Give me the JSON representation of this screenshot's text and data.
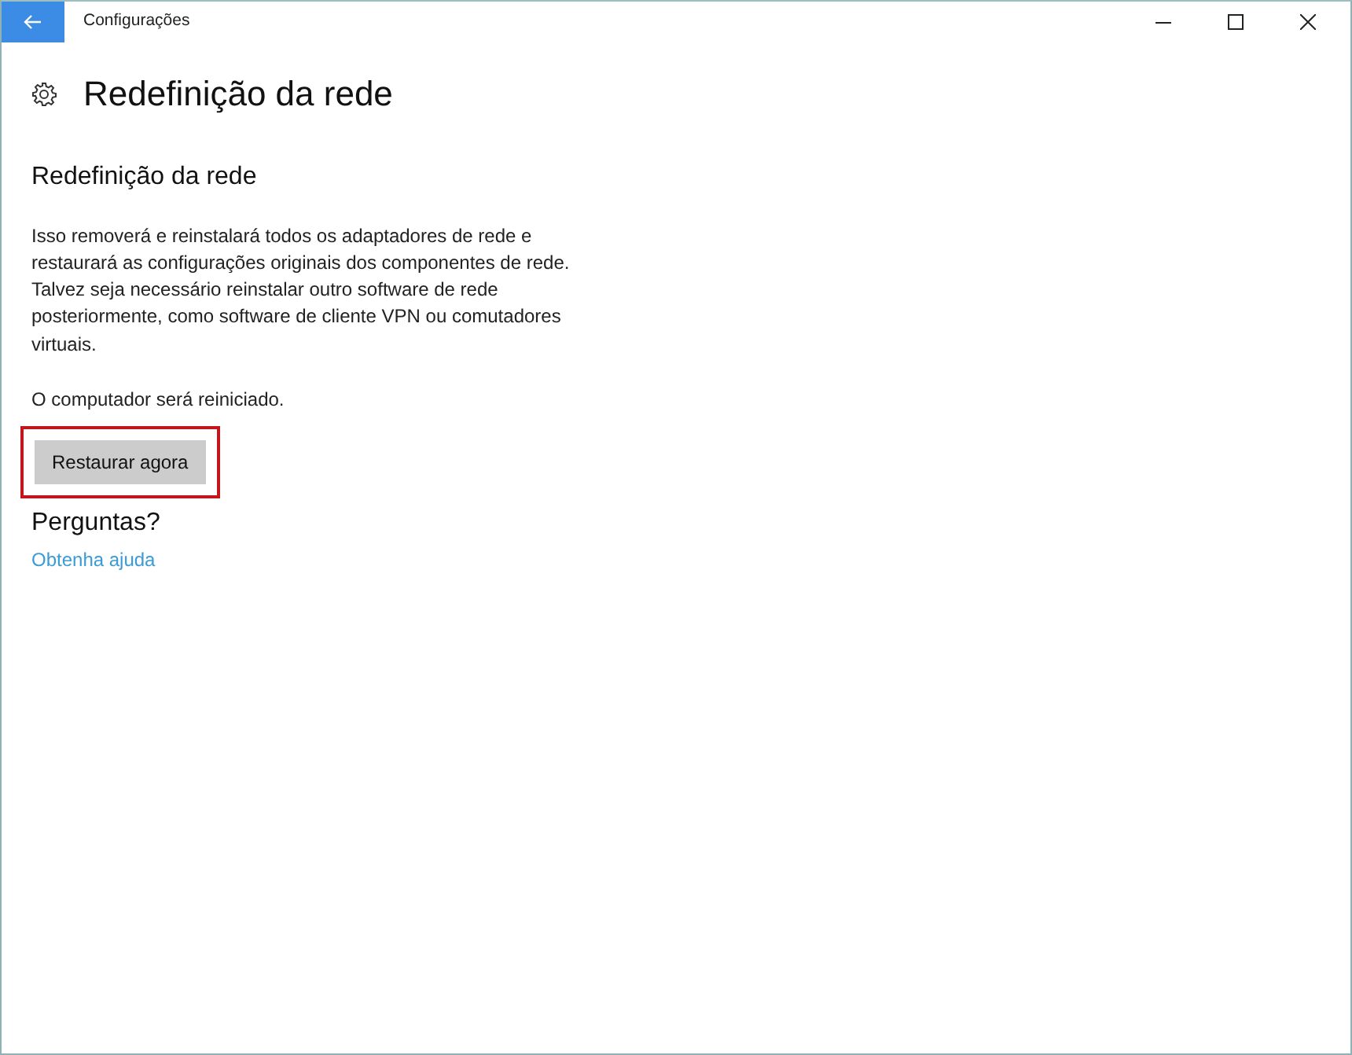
{
  "window": {
    "title": "Configurações"
  },
  "page": {
    "title": "Redefinição da rede"
  },
  "section": {
    "heading": "Redefinição da rede",
    "description_lines": [
      "Isso removerá e reinstalará todos os adaptadores de rede e",
      "restaurará as configurações originais dos componentes de rede.",
      "Talvez seja necessário reinstalar outro software de rede",
      "posteriormente, como software de cliente VPN ou comutadores",
      "virtuais."
    ],
    "note": "O computador será reiniciado.",
    "button": {
      "label": "Restaurar agora",
      "highlighted": true
    }
  },
  "help": {
    "heading": "Perguntas?",
    "link": "Obtenha ajuda"
  }
}
